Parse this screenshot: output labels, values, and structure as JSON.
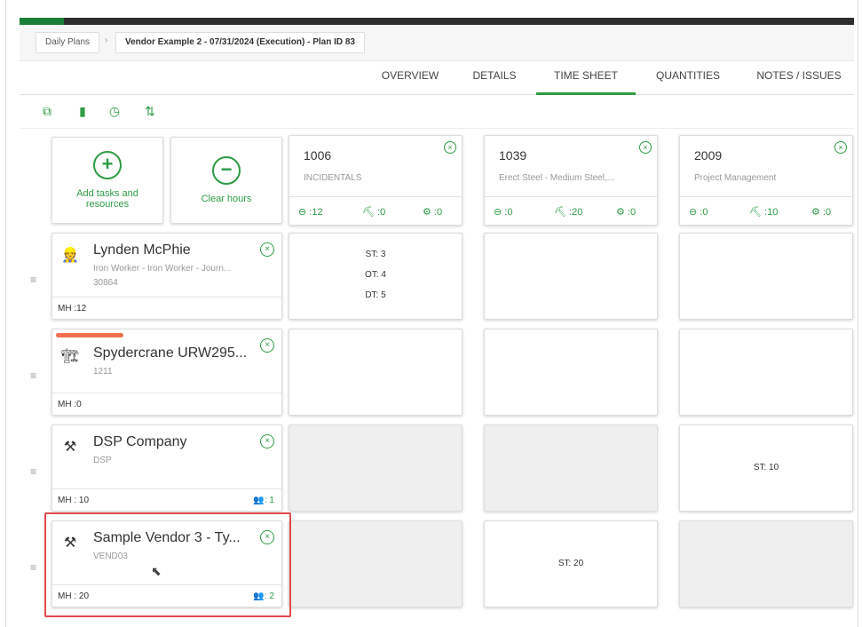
{
  "breadcrumb": {
    "items": [
      "Daily Plans",
      "Vendor Example 2 - 07/31/2024 (Execution) - Plan ID 83"
    ]
  },
  "tabs": [
    "OVERVIEW",
    "DETAILS",
    "TIME SHEET",
    "QUANTITIES",
    "NOTES / ISSUES"
  ],
  "active_tab": "TIME SHEET",
  "toolbar": {
    "icons": [
      "copy-icon",
      "attachment-icon",
      "clock-icon",
      "sort-icon"
    ]
  },
  "actions": {
    "add_label": "Add tasks and resources",
    "clear_label": "Clear hours"
  },
  "tasks": [
    {
      "code": "1006",
      "desc": "INCIDENTALS",
      "s1": ":12",
      "s2": ":0",
      "s3": ":0"
    },
    {
      "code": "1039",
      "desc": "Erect Steel - Medium Steel,...",
      "s1": ":0",
      "s2": ":20",
      "s3": ":0"
    },
    {
      "code": "2009",
      "desc": "Project Management",
      "s1": ":0",
      "s2": ":10",
      "s3": ":0"
    }
  ],
  "resources": [
    {
      "name": "Lynden McPhie",
      "sub": "Iron Worker - Iron Worker - Journ...",
      "sub2": "30864",
      "mh": "MH :12",
      "count": ""
    },
    {
      "name": "Spydercrane URW295...",
      "sub": "1211",
      "sub2": "",
      "mh": "MH :0",
      "count": ""
    },
    {
      "name": "DSP Company",
      "sub": "DSP",
      "sub2": "",
      "mh": "MH : 10",
      "count": ": 1"
    },
    {
      "name": "Sample Vendor 3 - Ty...",
      "sub": "VEND03",
      "sub2": "",
      "mh": "MH : 20",
      "count": ": 2"
    }
  ],
  "cells": {
    "r1c1": {
      "st": "ST: 3",
      "ot": "OT: 4",
      "dt": "DT: 5"
    },
    "r3c3": {
      "st": "ST: 10"
    },
    "r4c2": {
      "st": "ST: 20"
    }
  },
  "colors": {
    "accent": "#2e9b45",
    "highlight": "#e24b4b",
    "equipment_tag": "#f0704f"
  }
}
